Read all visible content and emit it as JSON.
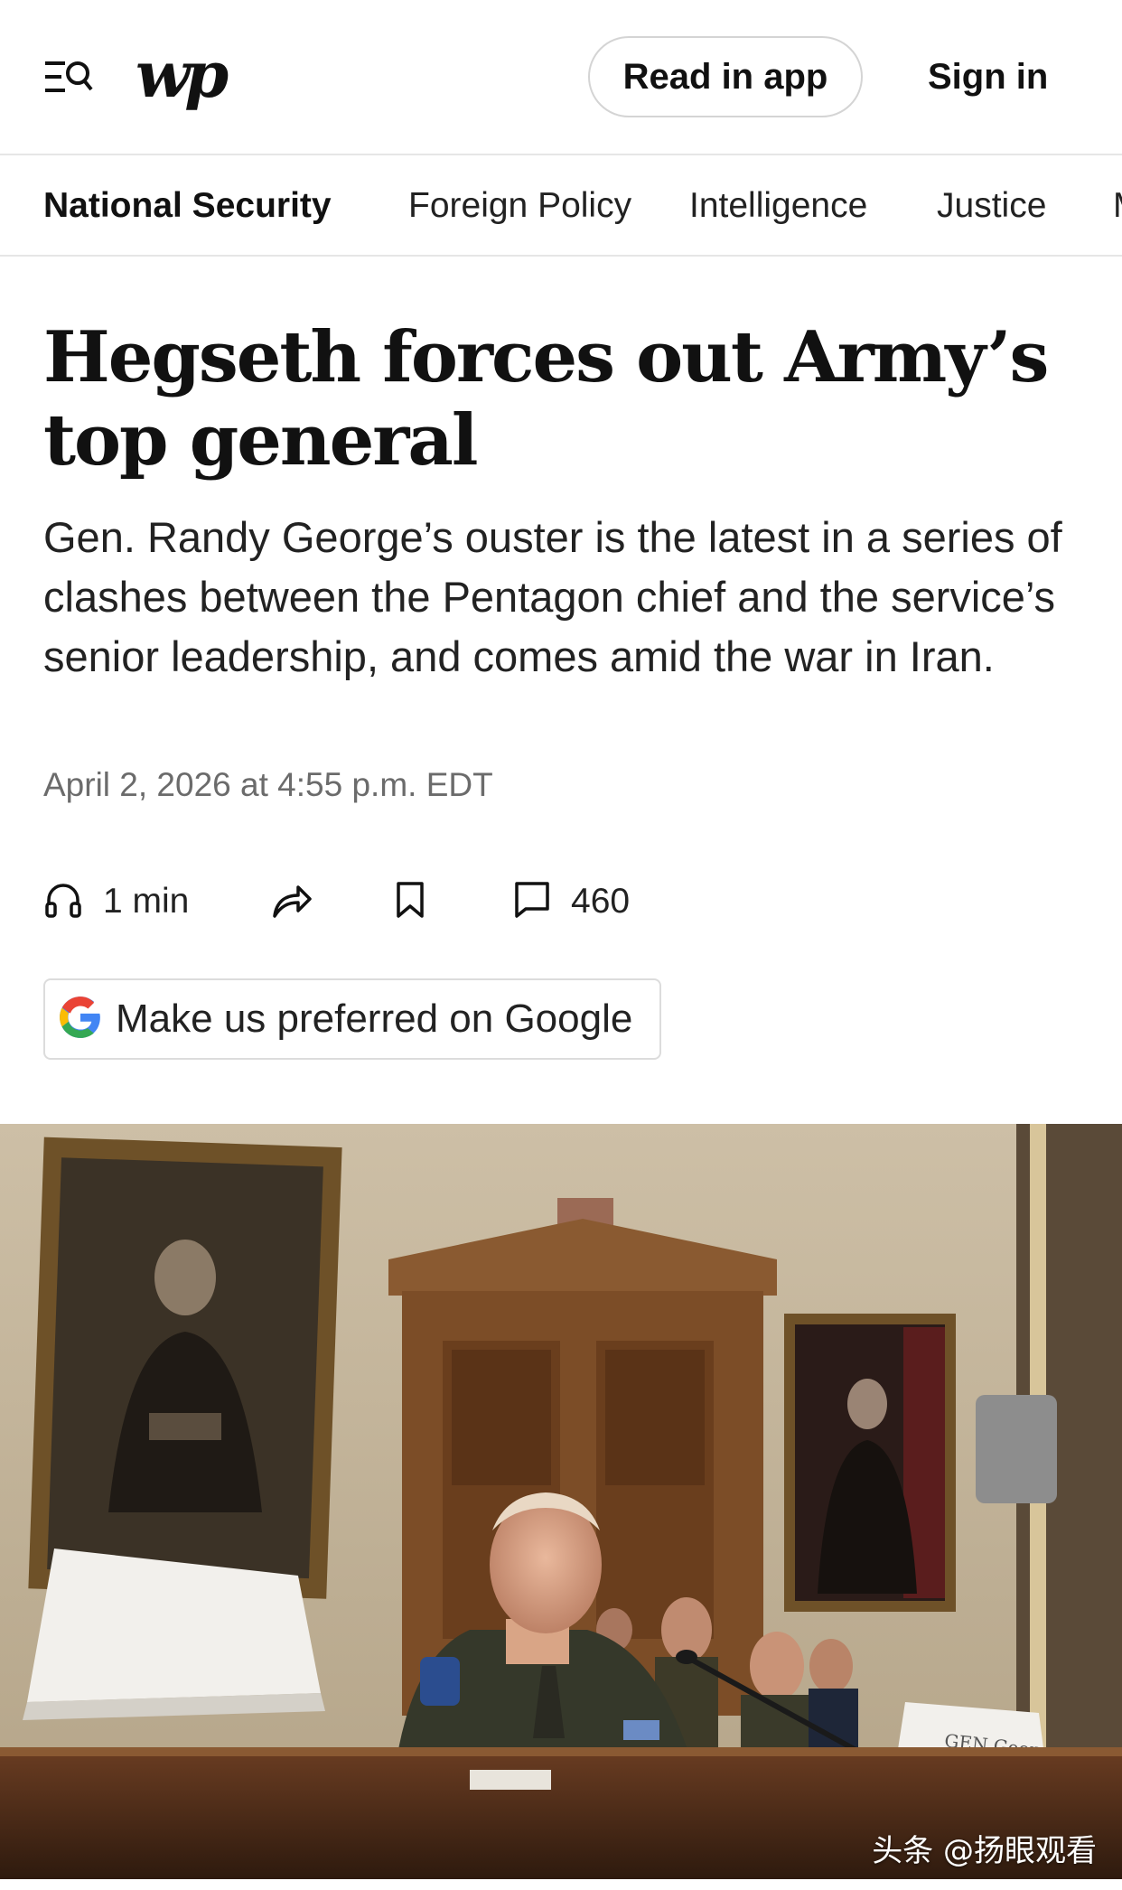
{
  "header": {
    "logo_text": "wp",
    "read_in_app_label": "Read in app",
    "sign_in_label": "Sign in"
  },
  "section_nav": {
    "items": [
      {
        "label": "National Security",
        "active": true
      },
      {
        "label": "Foreign Policy",
        "active": false
      },
      {
        "label": "Intelligence",
        "active": false
      },
      {
        "label": "Justice",
        "active": false
      },
      {
        "label": "M",
        "active": false
      }
    ]
  },
  "article": {
    "headline": "Hegseth forces out Army’s top general",
    "dek": "Gen. Randy George’s ouster is the latest in a series of clashes between the Pentagon chief and the service’s senior leadership, and comes amid the war in Iran.",
    "timestamp": "April 2, 2026 at 4:55 p.m. EDT"
  },
  "actions": {
    "listen_label": "1 min",
    "comments_count": "460"
  },
  "google_preferred": {
    "label": "Make us preferred on Google"
  },
  "photo": {
    "nameplate_right": "GEN George",
    "watermark": "头条 @扬眼观看"
  },
  "colors": {
    "border": "#e6e6e6",
    "text": "#111111",
    "muted": "#6b6b6b",
    "google_blue": "#4285F4",
    "google_red": "#EA4335",
    "google_yellow": "#FBBC05",
    "google_green": "#34A853"
  }
}
